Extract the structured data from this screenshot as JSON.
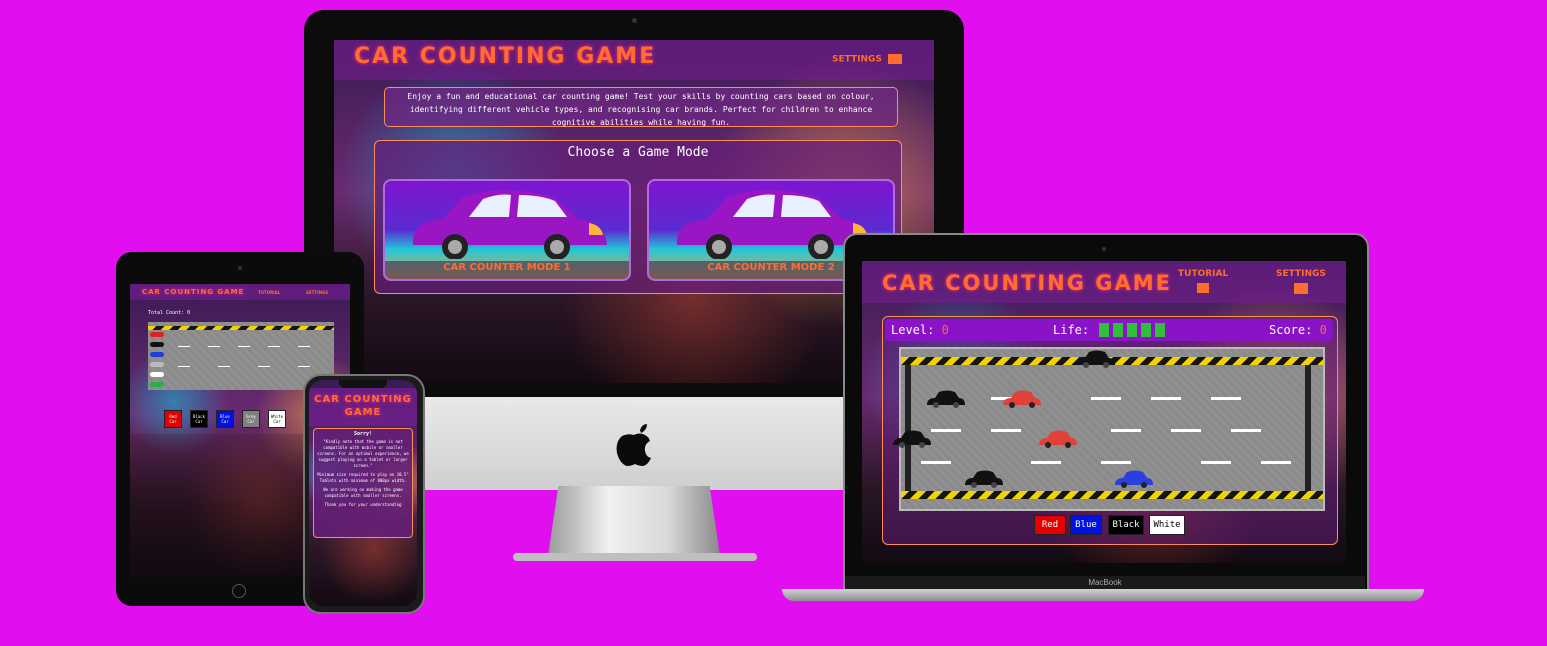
{
  "game": {
    "title": "CAR COUNTING GAME",
    "title_mobile_line1": "CAR COUNTING",
    "title_mobile_line2": "GAME",
    "nav_tutorial": "TUTORIAL",
    "nav_settings": "SETTINGS"
  },
  "imac": {
    "intro": "Enjoy a fun and educational car counting game! Test your skills by counting cars based on colour, identifying different vehicle types, and recognising car brands. Perfect for children to enhance cognitive abilities while having fun.",
    "choose_heading": "Choose a Game Mode",
    "mode1_label": "CAR COUNTER MODE 1",
    "mode2_label": "CAR COUNTER MODE 2"
  },
  "ipad": {
    "total_count": "Total Count: 0",
    "buttons": [
      "Red Car",
      "Black Car",
      "Blue Car",
      "Grey Car",
      "White Car"
    ]
  },
  "iphone": {
    "sorry": "Sorry!",
    "msg1": "\"Kindly note that the game is not compatible with mobile or smaller screens. For an optimal experience, we suggest playing on a tablet or larger screen.\"",
    "msg2": "Minimum size required to play on 10.5\" Tablets with minimum of 800px width.",
    "msg3": "We are working on making the game compatible with smaller screens.",
    "thanks": "Thank you for your understanding"
  },
  "macbook": {
    "level_label": "Level:",
    "level_value": "0",
    "life_label": "Life:",
    "life_blocks": 5,
    "score_label": "Score:",
    "score_value": "0",
    "buttons": [
      "Red",
      "Blue",
      "Black",
      "White"
    ],
    "brand": "MacBook"
  },
  "colors": {
    "background": "#e10ff0",
    "accent": "#ff6d2c",
    "purple": "#8a12c7",
    "life": "#2fbf3b"
  },
  "icons": [
    "settings-icon",
    "tutorial-icon",
    "apple-logo-icon"
  ]
}
